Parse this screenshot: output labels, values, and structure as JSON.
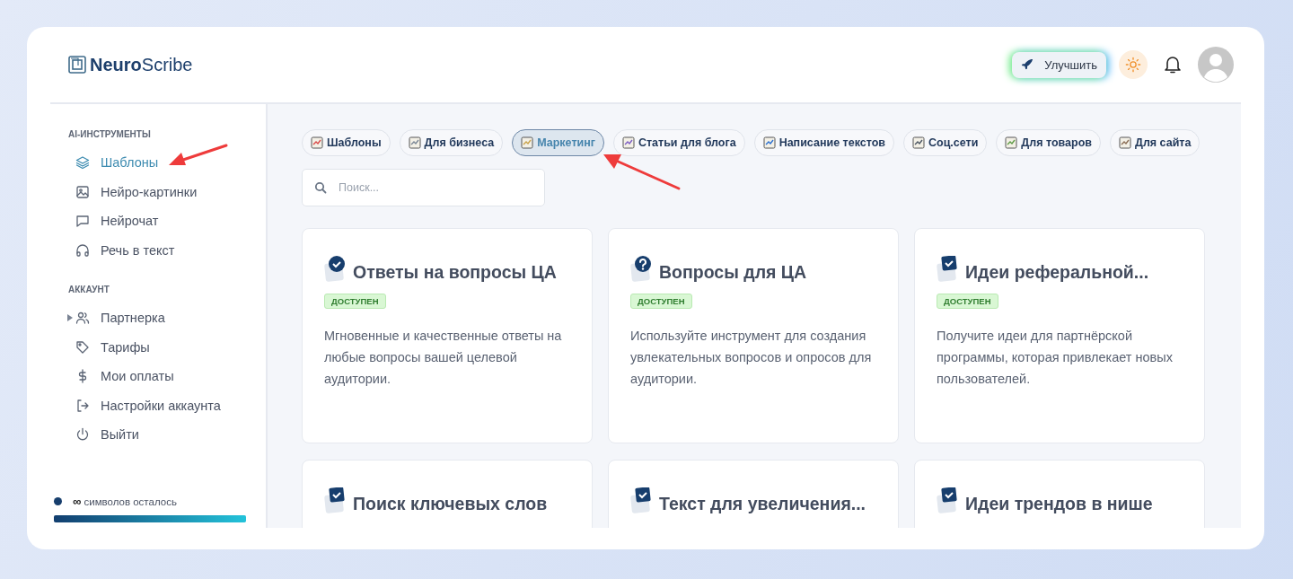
{
  "brand": {
    "bold": "Neuro",
    "light": "Scribe"
  },
  "header": {
    "upgrade_button": "Улучшить"
  },
  "sidebar": {
    "sections": [
      {
        "title": "AI-ИНСТРУМЕНТЫ",
        "items": [
          {
            "label": "Шаблоны",
            "selected": true
          },
          {
            "label": "Нейро-картинки",
            "selected": false
          },
          {
            "label": "Нейрочат",
            "selected": false
          },
          {
            "label": "Речь в текст",
            "selected": false
          }
        ]
      },
      {
        "title": "АККАУНТ",
        "items": [
          {
            "label": "Партнерка",
            "selected": false,
            "expanded": false
          },
          {
            "label": "Тарифы",
            "selected": false
          },
          {
            "label": "Мои оплаты",
            "selected": false
          },
          {
            "label": "Настройки аккаунта",
            "selected": false
          },
          {
            "label": "Выйти",
            "selected": false
          }
        ]
      }
    ],
    "credits": {
      "symbol": "∞",
      "label": "символов осталось",
      "level": 1
    }
  },
  "categories": [
    {
      "label": "Шаблоны",
      "selected": false
    },
    {
      "label": "Для бизнеса",
      "selected": false
    },
    {
      "label": "Маркетинг",
      "selected": true
    },
    {
      "label": "Статьи для блога",
      "selected": false
    },
    {
      "label": "Написание текстов",
      "selected": false
    },
    {
      "label": "Соц.сети",
      "selected": false
    },
    {
      "label": "Для товаров",
      "selected": false
    },
    {
      "label": "Для сайта",
      "selected": false
    }
  ],
  "search": {
    "placeholder": "Поиск..."
  },
  "templates": [
    {
      "title": "Ответы на вопросы ЦА",
      "kind": "check-circle",
      "badge": "ДОСТУПЕН",
      "description": "Мгновенные и качественные ответы на любые вопросы вашей целевой аудитории."
    },
    {
      "title": "Вопросы для ЦА",
      "kind": "question",
      "badge": "ДОСТУПЕН",
      "description": "Используйте инструмент для создания увлекательных вопросов и опросов для аудитории."
    },
    {
      "title": "Идеи реферальной...",
      "kind": "check-square",
      "badge": "ДОСТУПЕН",
      "description": "Получите идеи для партнёрской программы, которая привлекает новых пользователей."
    },
    {
      "title": "Поиск ключевых слов",
      "kind": "check-square"
    },
    {
      "title": "Текст для увеличения...",
      "kind": "check-square"
    },
    {
      "title": "Идеи трендов в нише",
      "kind": "check-square"
    }
  ]
}
